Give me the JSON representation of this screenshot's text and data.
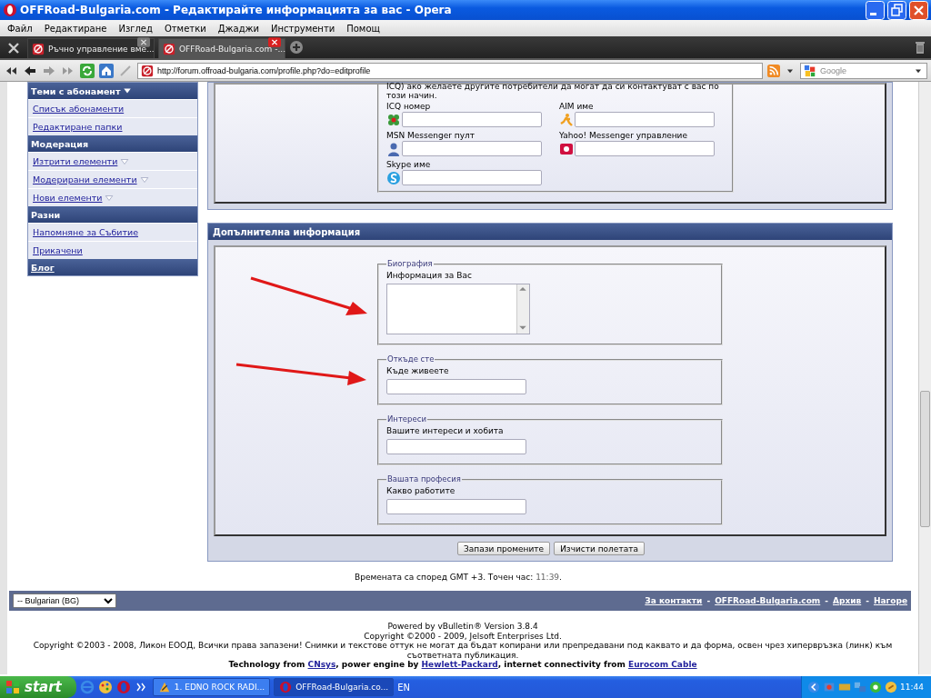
{
  "window": {
    "title": "OFFRoad-Bulgaria.com - Редактирайте информацията за вас - Opera"
  },
  "menu": [
    "Файл",
    "Редактиране",
    "Изглед",
    "Отметки",
    "Джаджи",
    "Инструменти",
    "Помощ"
  ],
  "tabs": [
    {
      "label": "Ръчно управление вме...",
      "selected": false
    },
    {
      "label": "OFFRoad-Bulgaria.com -...",
      "selected": true
    }
  ],
  "address_bar": {
    "url": "http://forum.offroad-bulgaria.com/profile.php?do=editprofile"
  },
  "search": {
    "placeholder": "Google"
  },
  "sidebar": {
    "sections": [
      {
        "title": "Теми с абонамент",
        "dropdown": true,
        "link": false,
        "items": [
          {
            "label": "Списък абонаменти",
            "menu": false
          },
          {
            "label": "Редактиране папки",
            "menu": false
          }
        ]
      },
      {
        "title": "Модерация",
        "dropdown": false,
        "link": false,
        "items": [
          {
            "label": "Изтрити елементи",
            "menu": true
          },
          {
            "label": "Модерирани елементи",
            "menu": true
          },
          {
            "label": "Нови елементи",
            "menu": true
          }
        ]
      },
      {
        "title": "Разни",
        "dropdown": false,
        "link": false,
        "items": [
          {
            "label": "Напомняне за Събитие",
            "menu": false
          },
          {
            "label": "Прикачени",
            "menu": false
          }
        ]
      },
      {
        "title": "Блог",
        "dropdown": false,
        "link": true
      }
    ]
  },
  "messenger": {
    "intro": "ICQ) ако желаете другите потребители да могат да си контактуват с вас по този начин.",
    "fields": [
      {
        "label": "ICQ номер",
        "kind": "icq"
      },
      {
        "label": "AIM име",
        "kind": "aim"
      },
      {
        "label": "MSN Messenger пулт",
        "kind": "msn"
      },
      {
        "label": "Yahoo! Messenger управление",
        "kind": "yahoo"
      },
      {
        "label": "Skype име",
        "kind": "skype"
      }
    ]
  },
  "additional_info": {
    "title": "Допълнителна информация",
    "groups": [
      {
        "legend": "Биография",
        "label": "Информация за Вас",
        "kind": "textarea"
      },
      {
        "legend": "Откъде сте",
        "label": "Къде живеете",
        "kind": "input"
      },
      {
        "legend": "Интереси",
        "label": "Вашите интереси и хобита",
        "kind": "input"
      },
      {
        "legend": "Вашата професия",
        "label": "Какво работите",
        "kind": "input"
      }
    ],
    "buttons": [
      "Запази промените",
      "Изчисти полетата"
    ]
  },
  "time_note": {
    "before": "Времената са според GMT +3. Точен час: ",
    "time": "11:39",
    "after": "."
  },
  "footer": {
    "language": "-- Bulgarian (BG)",
    "separator": "-",
    "links": [
      "За контакти",
      "OFFRoad-Bulgaria.com",
      "Архив",
      "Нагоре"
    ]
  },
  "copyright": [
    "Powered by vBulletin® Version 3.8.4",
    "Copyright ©2000 - 2009, Jelsoft Enterprises Ltd.",
    "Copyright ©2003 - 2008, Ликон ЕООД, Всички права запазени! Снимки и текстове оттук не могат да бъдат копирани или препредавани под каквато и да форма, освен чрез хипервръзка (линк) към съответната публикация."
  ],
  "credits": [
    {
      "text": "Technology from ",
      "link": "CNsys"
    },
    {
      "text": ", power engine by ",
      "link": "Hewlett-Packard"
    },
    {
      "text": ", internet connectivity from ",
      "link": "Eurocom Cable"
    }
  ],
  "taskbar": {
    "start": "start",
    "tasks": [
      {
        "label": "1. EDNO ROCK RADI...",
        "selected": false
      },
      {
        "label": "OFFRoad-Bulgaria.co...",
        "selected": true
      }
    ],
    "language": "EN",
    "clock": "11:44"
  }
}
